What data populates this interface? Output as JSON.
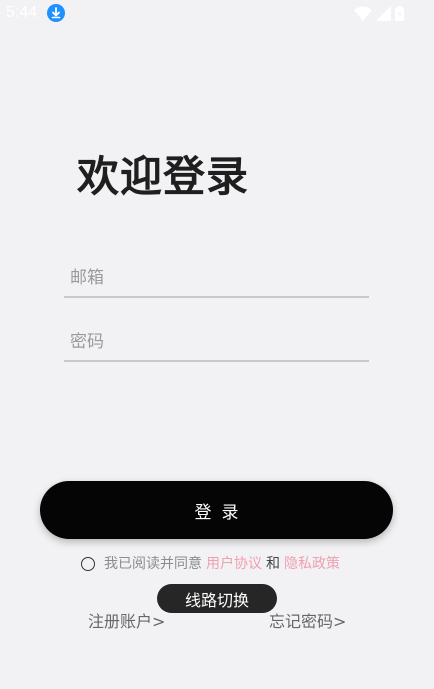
{
  "status_bar": {
    "time": "5:44",
    "icons": [
      "download-icon",
      "wifi-icon",
      "cell-signal-icon",
      "battery-icon"
    ]
  },
  "login": {
    "title": "欢迎登录",
    "email_placeholder": "邮箱",
    "password_placeholder": "密码",
    "login_label": "登录",
    "agreement": {
      "text": "我已阅读并同意",
      "user_agreement": "用户协议",
      "and": "和",
      "privacy_policy": "隐私政策"
    },
    "register_label": "注册账户>",
    "forgot_label": "忘记密码>",
    "route_switch_label": "线路切换"
  },
  "colors": {
    "background": "#f2f2f4",
    "button": "#050505",
    "link_pink": "#f0a0b0",
    "download_badge": "#1e90ff"
  }
}
